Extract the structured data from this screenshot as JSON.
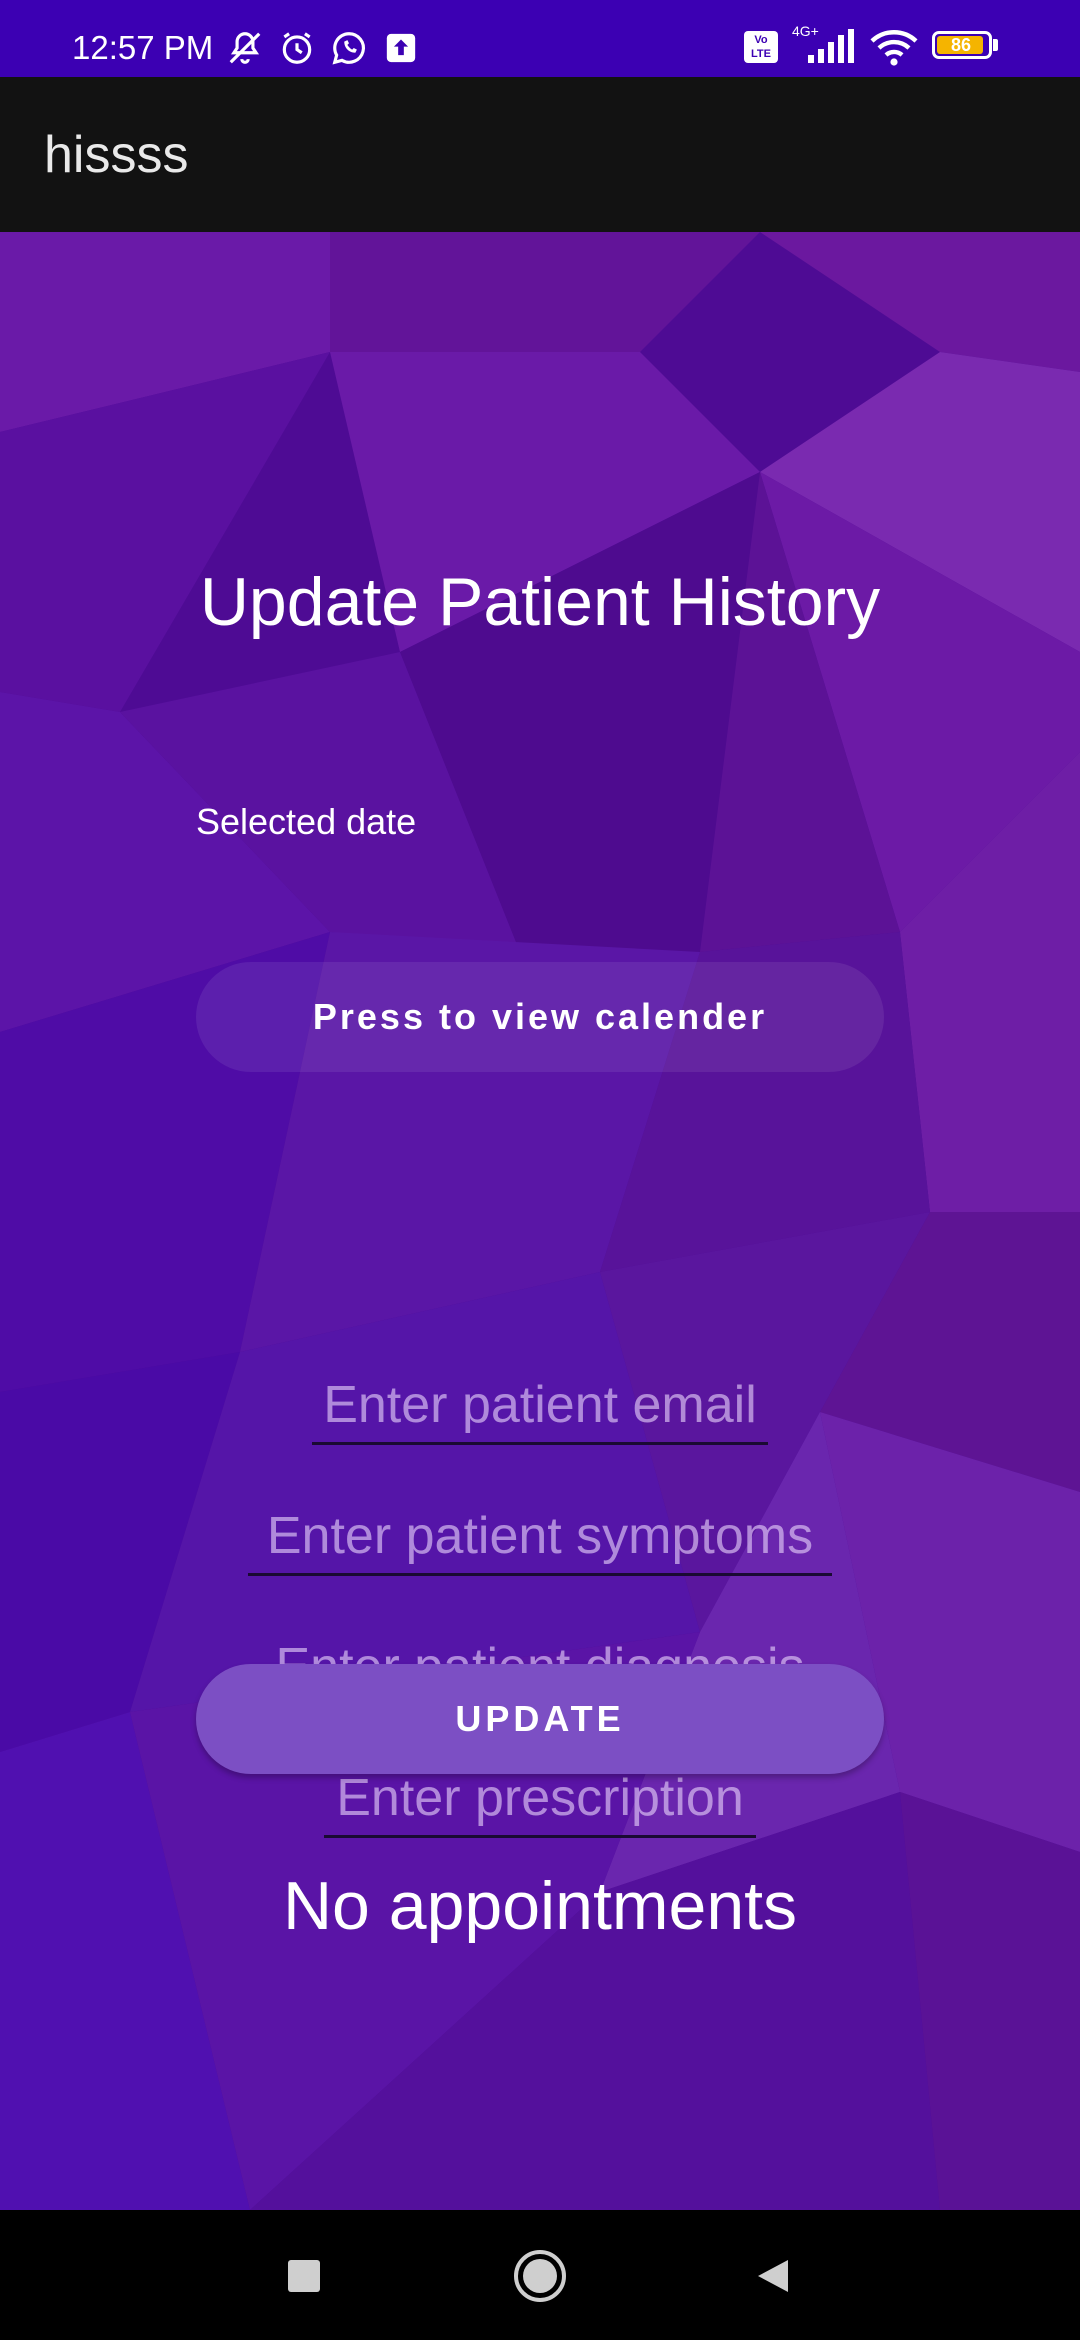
{
  "status_bar": {
    "time": "12:57 PM",
    "battery": "86",
    "network": "4G+",
    "volte": "Vo LTE",
    "icons_left": [
      "mute-icon",
      "alarm-icon",
      "whatsapp-icon",
      "upload-icon"
    ],
    "icons_right": [
      "volte-icon",
      "signal-icon",
      "wifi-icon",
      "battery-icon"
    ]
  },
  "app_bar": {
    "title": "hissss"
  },
  "main": {
    "heading": "Update Patient History",
    "selected_date_label": "Selected date",
    "calendar_button_label": "Press to view calender",
    "email_placeholder": "Enter patient email",
    "symptoms_placeholder": "Enter patient symptoms",
    "diagnosis_placeholder": "Enter patient diagnosis",
    "prescription_placeholder": "Enter prescription",
    "update_button_label": "UPDATE",
    "no_appointments_text": "No appointments"
  },
  "nav_bar": {
    "buttons": [
      "recents-square-icon",
      "home-circle-icon",
      "back-triangle-icon"
    ]
  },
  "colors": {
    "status_bar": "#3c00b3",
    "app_bar": "#121212",
    "background_purple": "#4b0a8c",
    "update_button": "#7c4fc4"
  }
}
